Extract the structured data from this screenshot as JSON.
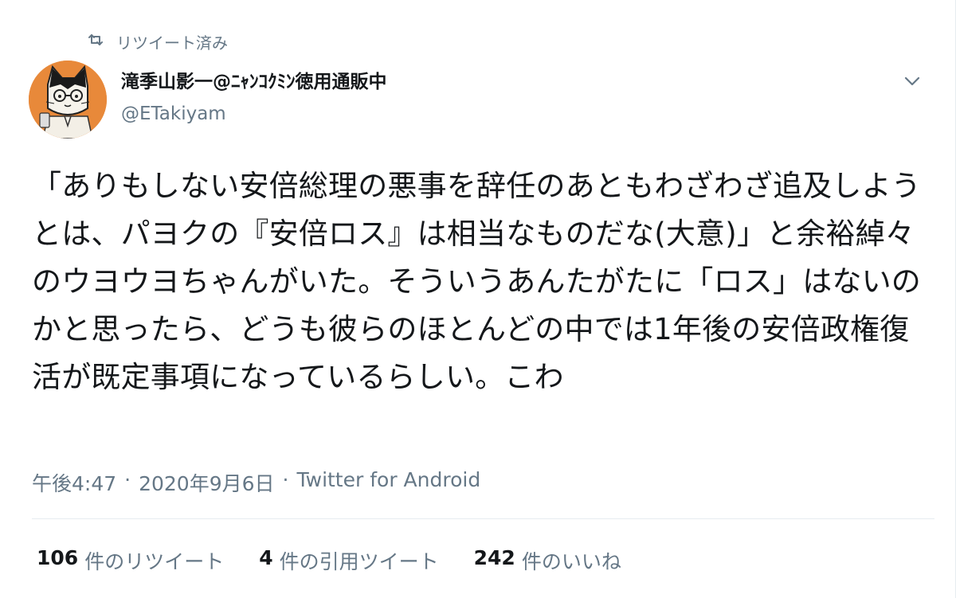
{
  "retweet": {
    "label": "リツイート済み",
    "icon": "retweet-icon"
  },
  "author": {
    "name": "滝季山影一@ﾆｬﾝｺｸﾐﾝ徳用通販中",
    "handle": "@ETakiyam",
    "avatar_icon": "cat-avatar",
    "avatar_bg": "#e8893a"
  },
  "menu": {
    "icon": "chevron-down-icon"
  },
  "tweet": {
    "text": "「ありもしない安倍総理の悪事を辞任のあともわざわざ追及しようとは、パヨクの『安倍ロス』は相当なものだな(大意)」と余裕綽々のウヨウヨちゃんがいた。そういうあんたがたに「ロス」はないのかと思ったら、どうも彼らのほとんどの中では1年後の安倍政権復活が既定事項になっているらしい。こわ"
  },
  "meta": {
    "time": "午後4:47",
    "sep1": "·",
    "date": "2020年9月6日",
    "sep2": "·",
    "source": "Twitter for Android"
  },
  "stats": {
    "retweets": {
      "count": "106",
      "label": "件のリツイート"
    },
    "quotes": {
      "count": "4",
      "label": "件の引用ツイート"
    },
    "likes": {
      "count": "242",
      "label": "件のいいね"
    }
  },
  "colors": {
    "text": "#14171a",
    "secondary": "#657786",
    "divider": "#e6ecf0"
  }
}
